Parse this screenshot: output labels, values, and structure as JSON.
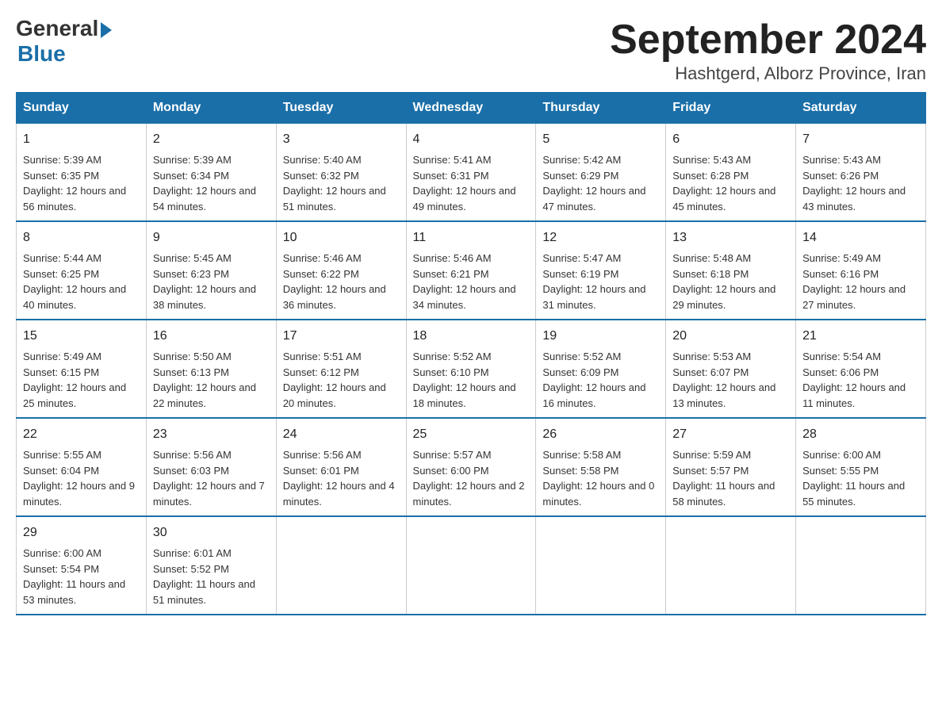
{
  "logo": {
    "general": "General",
    "blue": "Blue"
  },
  "title": "September 2024",
  "location": "Hashtgerd, Alborz Province, Iran",
  "headers": [
    "Sunday",
    "Monday",
    "Tuesday",
    "Wednesday",
    "Thursday",
    "Friday",
    "Saturday"
  ],
  "weeks": [
    [
      {
        "day": "1",
        "sunrise": "5:39 AM",
        "sunset": "6:35 PM",
        "daylight": "12 hours and 56 minutes."
      },
      {
        "day": "2",
        "sunrise": "5:39 AM",
        "sunset": "6:34 PM",
        "daylight": "12 hours and 54 minutes."
      },
      {
        "day": "3",
        "sunrise": "5:40 AM",
        "sunset": "6:32 PM",
        "daylight": "12 hours and 51 minutes."
      },
      {
        "day": "4",
        "sunrise": "5:41 AM",
        "sunset": "6:31 PM",
        "daylight": "12 hours and 49 minutes."
      },
      {
        "day": "5",
        "sunrise": "5:42 AM",
        "sunset": "6:29 PM",
        "daylight": "12 hours and 47 minutes."
      },
      {
        "day": "6",
        "sunrise": "5:43 AM",
        "sunset": "6:28 PM",
        "daylight": "12 hours and 45 minutes."
      },
      {
        "day": "7",
        "sunrise": "5:43 AM",
        "sunset": "6:26 PM",
        "daylight": "12 hours and 43 minutes."
      }
    ],
    [
      {
        "day": "8",
        "sunrise": "5:44 AM",
        "sunset": "6:25 PM",
        "daylight": "12 hours and 40 minutes."
      },
      {
        "day": "9",
        "sunrise": "5:45 AM",
        "sunset": "6:23 PM",
        "daylight": "12 hours and 38 minutes."
      },
      {
        "day": "10",
        "sunrise": "5:46 AM",
        "sunset": "6:22 PM",
        "daylight": "12 hours and 36 minutes."
      },
      {
        "day": "11",
        "sunrise": "5:46 AM",
        "sunset": "6:21 PM",
        "daylight": "12 hours and 34 minutes."
      },
      {
        "day": "12",
        "sunrise": "5:47 AM",
        "sunset": "6:19 PM",
        "daylight": "12 hours and 31 minutes."
      },
      {
        "day": "13",
        "sunrise": "5:48 AM",
        "sunset": "6:18 PM",
        "daylight": "12 hours and 29 minutes."
      },
      {
        "day": "14",
        "sunrise": "5:49 AM",
        "sunset": "6:16 PM",
        "daylight": "12 hours and 27 minutes."
      }
    ],
    [
      {
        "day": "15",
        "sunrise": "5:49 AM",
        "sunset": "6:15 PM",
        "daylight": "12 hours and 25 minutes."
      },
      {
        "day": "16",
        "sunrise": "5:50 AM",
        "sunset": "6:13 PM",
        "daylight": "12 hours and 22 minutes."
      },
      {
        "day": "17",
        "sunrise": "5:51 AM",
        "sunset": "6:12 PM",
        "daylight": "12 hours and 20 minutes."
      },
      {
        "day": "18",
        "sunrise": "5:52 AM",
        "sunset": "6:10 PM",
        "daylight": "12 hours and 18 minutes."
      },
      {
        "day": "19",
        "sunrise": "5:52 AM",
        "sunset": "6:09 PM",
        "daylight": "12 hours and 16 minutes."
      },
      {
        "day": "20",
        "sunrise": "5:53 AM",
        "sunset": "6:07 PM",
        "daylight": "12 hours and 13 minutes."
      },
      {
        "day": "21",
        "sunrise": "5:54 AM",
        "sunset": "6:06 PM",
        "daylight": "12 hours and 11 minutes."
      }
    ],
    [
      {
        "day": "22",
        "sunrise": "5:55 AM",
        "sunset": "6:04 PM",
        "daylight": "12 hours and 9 minutes."
      },
      {
        "day": "23",
        "sunrise": "5:56 AM",
        "sunset": "6:03 PM",
        "daylight": "12 hours and 7 minutes."
      },
      {
        "day": "24",
        "sunrise": "5:56 AM",
        "sunset": "6:01 PM",
        "daylight": "12 hours and 4 minutes."
      },
      {
        "day": "25",
        "sunrise": "5:57 AM",
        "sunset": "6:00 PM",
        "daylight": "12 hours and 2 minutes."
      },
      {
        "day": "26",
        "sunrise": "5:58 AM",
        "sunset": "5:58 PM",
        "daylight": "12 hours and 0 minutes."
      },
      {
        "day": "27",
        "sunrise": "5:59 AM",
        "sunset": "5:57 PM",
        "daylight": "11 hours and 58 minutes."
      },
      {
        "day": "28",
        "sunrise": "6:00 AM",
        "sunset": "5:55 PM",
        "daylight": "11 hours and 55 minutes."
      }
    ],
    [
      {
        "day": "29",
        "sunrise": "6:00 AM",
        "sunset": "5:54 PM",
        "daylight": "11 hours and 53 minutes."
      },
      {
        "day": "30",
        "sunrise": "6:01 AM",
        "sunset": "5:52 PM",
        "daylight": "11 hours and 51 minutes."
      },
      null,
      null,
      null,
      null,
      null
    ]
  ]
}
